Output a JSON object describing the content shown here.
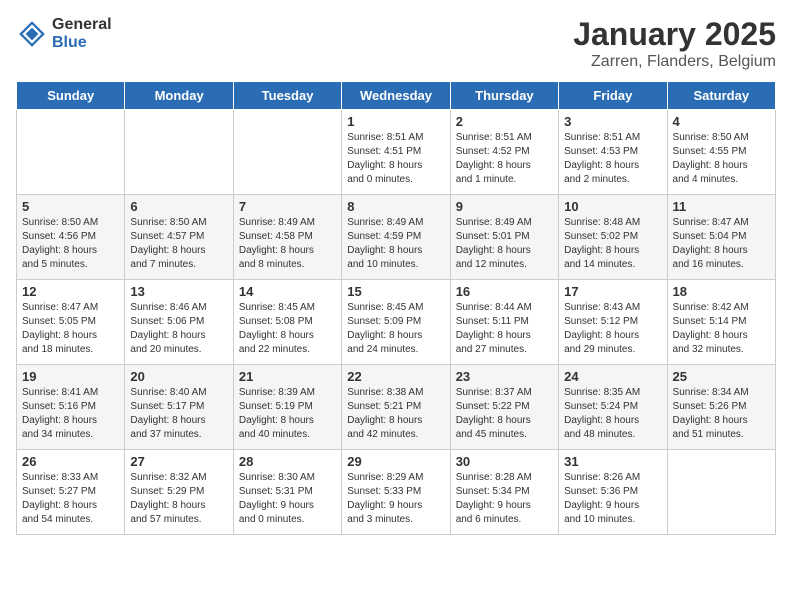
{
  "header": {
    "logo_general": "General",
    "logo_blue": "Blue",
    "month_title": "January 2025",
    "location": "Zarren, Flanders, Belgium"
  },
  "weekdays": [
    "Sunday",
    "Monday",
    "Tuesday",
    "Wednesday",
    "Thursday",
    "Friday",
    "Saturday"
  ],
  "weeks": [
    [
      {
        "day": "",
        "content": ""
      },
      {
        "day": "",
        "content": ""
      },
      {
        "day": "",
        "content": ""
      },
      {
        "day": "1",
        "content": "Sunrise: 8:51 AM\nSunset: 4:51 PM\nDaylight: 8 hours\nand 0 minutes."
      },
      {
        "day": "2",
        "content": "Sunrise: 8:51 AM\nSunset: 4:52 PM\nDaylight: 8 hours\nand 1 minute."
      },
      {
        "day": "3",
        "content": "Sunrise: 8:51 AM\nSunset: 4:53 PM\nDaylight: 8 hours\nand 2 minutes."
      },
      {
        "day": "4",
        "content": "Sunrise: 8:50 AM\nSunset: 4:55 PM\nDaylight: 8 hours\nand 4 minutes."
      }
    ],
    [
      {
        "day": "5",
        "content": "Sunrise: 8:50 AM\nSunset: 4:56 PM\nDaylight: 8 hours\nand 5 minutes."
      },
      {
        "day": "6",
        "content": "Sunrise: 8:50 AM\nSunset: 4:57 PM\nDaylight: 8 hours\nand 7 minutes."
      },
      {
        "day": "7",
        "content": "Sunrise: 8:49 AM\nSunset: 4:58 PM\nDaylight: 8 hours\nand 8 minutes."
      },
      {
        "day": "8",
        "content": "Sunrise: 8:49 AM\nSunset: 4:59 PM\nDaylight: 8 hours\nand 10 minutes."
      },
      {
        "day": "9",
        "content": "Sunrise: 8:49 AM\nSunset: 5:01 PM\nDaylight: 8 hours\nand 12 minutes."
      },
      {
        "day": "10",
        "content": "Sunrise: 8:48 AM\nSunset: 5:02 PM\nDaylight: 8 hours\nand 14 minutes."
      },
      {
        "day": "11",
        "content": "Sunrise: 8:47 AM\nSunset: 5:04 PM\nDaylight: 8 hours\nand 16 minutes."
      }
    ],
    [
      {
        "day": "12",
        "content": "Sunrise: 8:47 AM\nSunset: 5:05 PM\nDaylight: 8 hours\nand 18 minutes."
      },
      {
        "day": "13",
        "content": "Sunrise: 8:46 AM\nSunset: 5:06 PM\nDaylight: 8 hours\nand 20 minutes."
      },
      {
        "day": "14",
        "content": "Sunrise: 8:45 AM\nSunset: 5:08 PM\nDaylight: 8 hours\nand 22 minutes."
      },
      {
        "day": "15",
        "content": "Sunrise: 8:45 AM\nSunset: 5:09 PM\nDaylight: 8 hours\nand 24 minutes."
      },
      {
        "day": "16",
        "content": "Sunrise: 8:44 AM\nSunset: 5:11 PM\nDaylight: 8 hours\nand 27 minutes."
      },
      {
        "day": "17",
        "content": "Sunrise: 8:43 AM\nSunset: 5:12 PM\nDaylight: 8 hours\nand 29 minutes."
      },
      {
        "day": "18",
        "content": "Sunrise: 8:42 AM\nSunset: 5:14 PM\nDaylight: 8 hours\nand 32 minutes."
      }
    ],
    [
      {
        "day": "19",
        "content": "Sunrise: 8:41 AM\nSunset: 5:16 PM\nDaylight: 8 hours\nand 34 minutes."
      },
      {
        "day": "20",
        "content": "Sunrise: 8:40 AM\nSunset: 5:17 PM\nDaylight: 8 hours\nand 37 minutes."
      },
      {
        "day": "21",
        "content": "Sunrise: 8:39 AM\nSunset: 5:19 PM\nDaylight: 8 hours\nand 40 minutes."
      },
      {
        "day": "22",
        "content": "Sunrise: 8:38 AM\nSunset: 5:21 PM\nDaylight: 8 hours\nand 42 minutes."
      },
      {
        "day": "23",
        "content": "Sunrise: 8:37 AM\nSunset: 5:22 PM\nDaylight: 8 hours\nand 45 minutes."
      },
      {
        "day": "24",
        "content": "Sunrise: 8:35 AM\nSunset: 5:24 PM\nDaylight: 8 hours\nand 48 minutes."
      },
      {
        "day": "25",
        "content": "Sunrise: 8:34 AM\nSunset: 5:26 PM\nDaylight: 8 hours\nand 51 minutes."
      }
    ],
    [
      {
        "day": "26",
        "content": "Sunrise: 8:33 AM\nSunset: 5:27 PM\nDaylight: 8 hours\nand 54 minutes."
      },
      {
        "day": "27",
        "content": "Sunrise: 8:32 AM\nSunset: 5:29 PM\nDaylight: 8 hours\nand 57 minutes."
      },
      {
        "day": "28",
        "content": "Sunrise: 8:30 AM\nSunset: 5:31 PM\nDaylight: 9 hours\nand 0 minutes."
      },
      {
        "day": "29",
        "content": "Sunrise: 8:29 AM\nSunset: 5:33 PM\nDaylight: 9 hours\nand 3 minutes."
      },
      {
        "day": "30",
        "content": "Sunrise: 8:28 AM\nSunset: 5:34 PM\nDaylight: 9 hours\nand 6 minutes."
      },
      {
        "day": "31",
        "content": "Sunrise: 8:26 AM\nSunset: 5:36 PM\nDaylight: 9 hours\nand 10 minutes."
      },
      {
        "day": "",
        "content": ""
      }
    ]
  ]
}
